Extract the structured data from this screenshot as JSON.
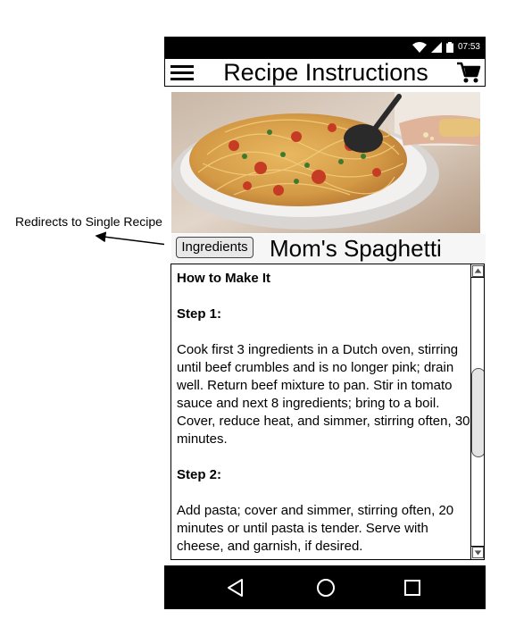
{
  "annotation": {
    "text": "Redirects to Single Recipe"
  },
  "status_bar": {
    "time": "07:53",
    "icons": [
      "wifi-icon",
      "signal-icon",
      "battery-icon"
    ]
  },
  "app_bar": {
    "title": "Recipe Instructions",
    "menu_icon": "menu-icon",
    "cart_icon": "cart-icon"
  },
  "recipe": {
    "ingredients_button_label": "Ingredients",
    "title": "Mom's Spaghetti",
    "hero_image": "spaghetti-photo"
  },
  "instructions": {
    "heading": "How to Make It",
    "steps": [
      {
        "label": "Step 1:",
        "text": "Cook first 3 ingredients in a Dutch oven, stirring until beef crumbles and is no longer pink; drain well. Return beef mixture to pan. Stir in tomato sauce and next 8 ingredients; bring to a boil. Cover, reduce heat, and simmer, stirring often, 30 minutes."
      },
      {
        "label": "Step 2:",
        "text": "Add pasta; cover and simmer, stirring often, 20 minutes or until pasta is tender. Serve with cheese, and garnish, if desired."
      }
    ]
  },
  "nav_bar": {
    "buttons": [
      "back-icon",
      "home-icon",
      "recents-icon"
    ]
  }
}
